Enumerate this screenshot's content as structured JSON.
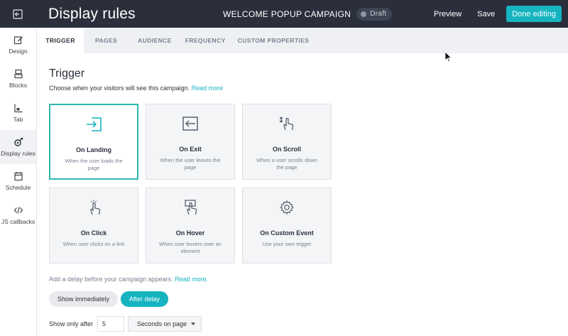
{
  "header": {
    "title": "Display rules",
    "campaign_name": "WELCOME POPUP CAMPAIGN",
    "status": "Draft",
    "preview_label": "Preview",
    "save_label": "Save",
    "done_label": "Done editing"
  },
  "sidebar": {
    "items": [
      {
        "label": "Design",
        "icon": "pencil-square-icon"
      },
      {
        "label": "Blocks",
        "icon": "blocks-icon"
      },
      {
        "label": "Tab",
        "icon": "tab-icon"
      },
      {
        "label": "Display rules",
        "icon": "display-rules-icon"
      },
      {
        "label": "Schedule",
        "icon": "calendar-icon"
      },
      {
        "label": "JS callbacks",
        "icon": "code-icon"
      }
    ]
  },
  "tabs": [
    "TRIGGER",
    "PAGES",
    "AUDIENCE",
    "FREQUENCY",
    "CUSTOM PROPERTIES"
  ],
  "trigger": {
    "heading": "Trigger",
    "subtext": "Choose when your visitors will see this campaign.",
    "read_more": "Read more",
    "cards": [
      {
        "title": "On Landing",
        "desc": "When the user loads the page",
        "icon": "enter-icon"
      },
      {
        "title": "On Exit",
        "desc": "When the user leaves the page",
        "icon": "exit-icon"
      },
      {
        "title": "On Scroll",
        "desc": "When a user scrolls down the page",
        "icon": "scroll-hand-icon"
      },
      {
        "title": "On Click",
        "desc": "When user clicks on a link",
        "icon": "click-hand-icon"
      },
      {
        "title": "On Hover",
        "desc": "When user hovers over an element",
        "icon": "hover-hand-icon"
      },
      {
        "title": "On Custom Event",
        "desc": "Use your own trigger",
        "icon": "gear-icon"
      }
    ]
  },
  "delay": {
    "text": "Add a delay before your campaign appears.",
    "read_more": "Read more.",
    "show_immediately": "Show immediately",
    "after_delay": "After delay",
    "show_only_after": "Show only after",
    "value": "5",
    "unit": "Seconds on page"
  },
  "colors": {
    "topbar": "#2a2f3b",
    "accent": "#16b4c0",
    "selected_border": "#2bb7b2"
  }
}
